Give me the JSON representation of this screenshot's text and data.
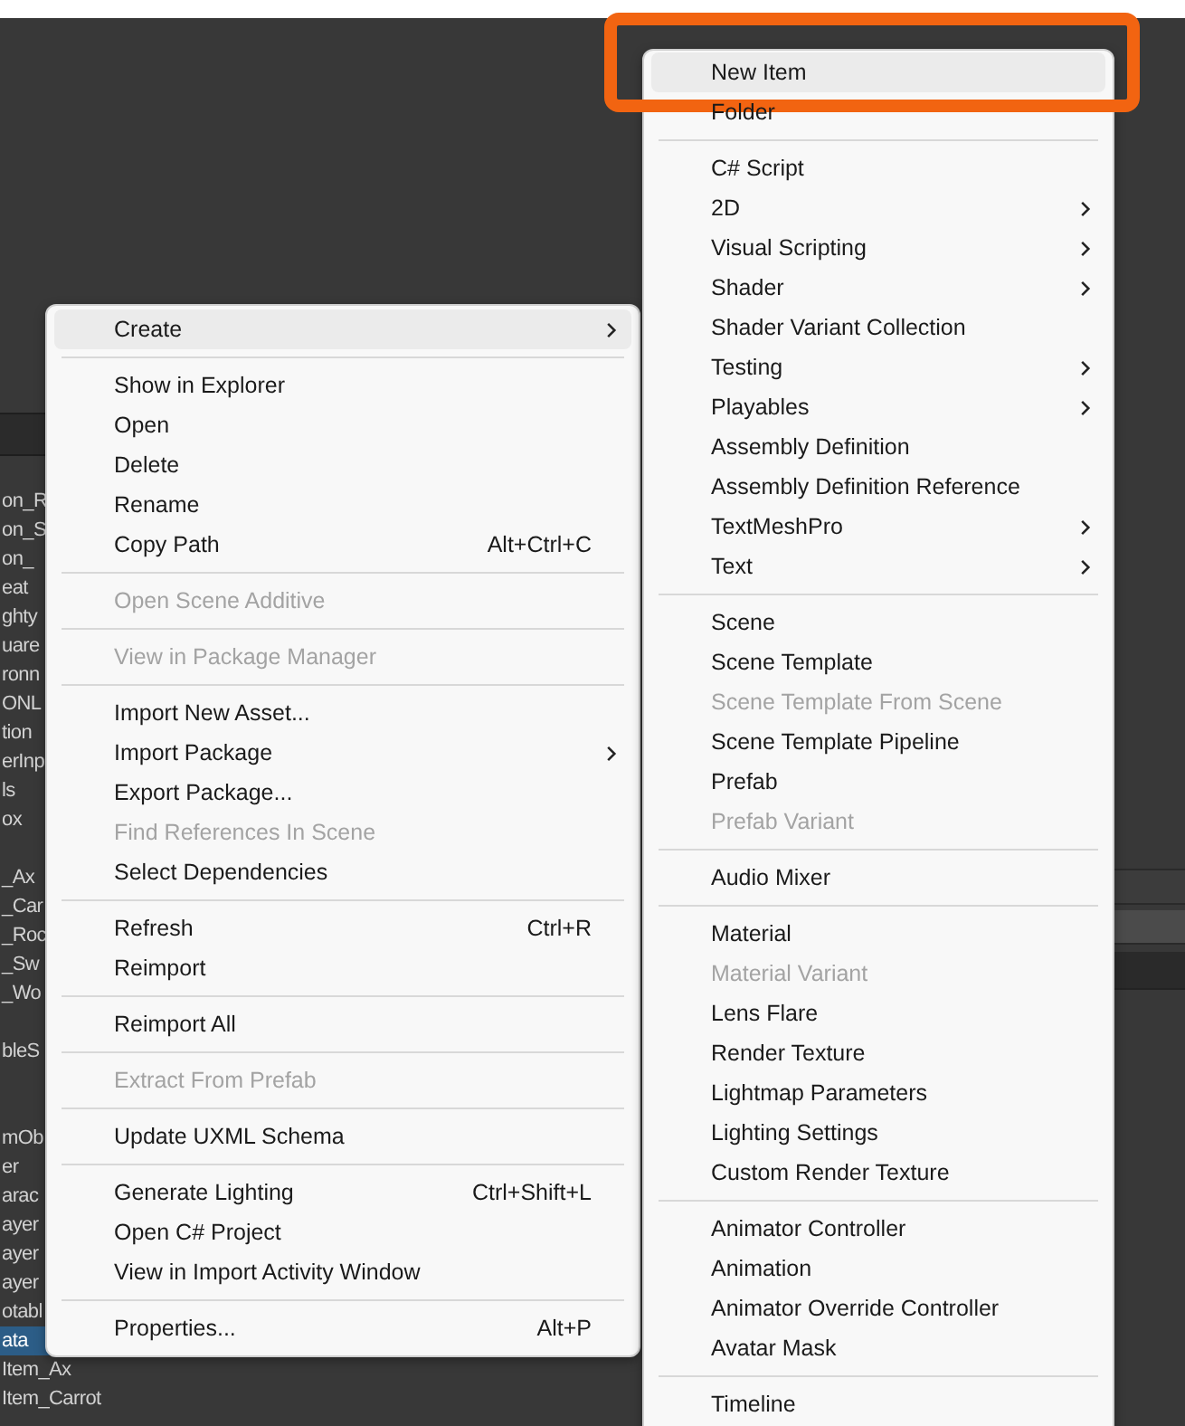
{
  "project_list": [
    {
      "kind": "name",
      "text": "on_R",
      "selected": false
    },
    {
      "kind": "name",
      "text": "on_S",
      "selected": false
    },
    {
      "kind": "name",
      "text": "on_",
      "selected": false
    },
    {
      "kind": "name",
      "text": "eat",
      "selected": false
    },
    {
      "kind": "name",
      "text": "ghty",
      "selected": false
    },
    {
      "kind": "name",
      "text": "uare",
      "selected": false
    },
    {
      "kind": "name",
      "text": "ronn",
      "selected": false
    },
    {
      "kind": "name",
      "text": "ONL",
      "selected": false
    },
    {
      "kind": "name",
      "text": "tion",
      "selected": false
    },
    {
      "kind": "name",
      "text": "erInp",
      "selected": false
    },
    {
      "kind": "name",
      "text": "ls",
      "selected": false
    },
    {
      "kind": "name",
      "text": "ox",
      "selected": false
    },
    {
      "kind": "empty"
    },
    {
      "kind": "name",
      "text": "_Ax",
      "selected": false
    },
    {
      "kind": "name",
      "text": "_Car",
      "selected": false
    },
    {
      "kind": "name",
      "text": "_Roc",
      "selected": false
    },
    {
      "kind": "name",
      "text": "_Sw",
      "selected": false
    },
    {
      "kind": "name",
      "text": "_Wo",
      "selected": false
    },
    {
      "kind": "empty"
    },
    {
      "kind": "name",
      "text": "bleS",
      "selected": false
    },
    {
      "kind": "empty"
    },
    {
      "kind": "empty"
    },
    {
      "kind": "name",
      "text": "mOb",
      "selected": false
    },
    {
      "kind": "name",
      "text": "er",
      "selected": false
    },
    {
      "kind": "name",
      "text": "arac",
      "selected": false
    },
    {
      "kind": "name",
      "text": "ayer",
      "selected": false
    },
    {
      "kind": "name",
      "text": "ayer",
      "selected": false
    },
    {
      "kind": "name",
      "text": "ayer",
      "selected": false
    },
    {
      "kind": "name",
      "text": "otabl",
      "selected": false
    },
    {
      "kind": "name",
      "text": "ata",
      "selected": true
    },
    {
      "kind": "name",
      "text": "Item_Ax",
      "selected": false
    },
    {
      "kind": "name",
      "text": "Item_Carrot",
      "selected": false
    }
  ],
  "context_menu": {
    "items": [
      {
        "kind": "item",
        "label": "Create",
        "submenu": true,
        "highlighted": true,
        "disabled": false
      },
      {
        "kind": "separator"
      },
      {
        "kind": "item",
        "label": "Show in Explorer",
        "submenu": false,
        "highlighted": false,
        "disabled": false
      },
      {
        "kind": "item",
        "label": "Open",
        "submenu": false,
        "highlighted": false,
        "disabled": false
      },
      {
        "kind": "item",
        "label": "Delete",
        "submenu": false,
        "highlighted": false,
        "disabled": false
      },
      {
        "kind": "item",
        "label": "Rename",
        "submenu": false,
        "highlighted": false,
        "disabled": false
      },
      {
        "kind": "item",
        "label": "Copy Path",
        "shortcut": "Alt+Ctrl+C",
        "submenu": false,
        "highlighted": false,
        "disabled": false
      },
      {
        "kind": "separator"
      },
      {
        "kind": "item",
        "label": "Open Scene Additive",
        "submenu": false,
        "highlighted": false,
        "disabled": true
      },
      {
        "kind": "separator"
      },
      {
        "kind": "item",
        "label": "View in Package Manager",
        "submenu": false,
        "highlighted": false,
        "disabled": true
      },
      {
        "kind": "separator"
      },
      {
        "kind": "item",
        "label": "Import New Asset...",
        "submenu": false,
        "highlighted": false,
        "disabled": false
      },
      {
        "kind": "item",
        "label": "Import Package",
        "submenu": true,
        "highlighted": false,
        "disabled": false
      },
      {
        "kind": "item",
        "label": "Export Package...",
        "submenu": false,
        "highlighted": false,
        "disabled": false
      },
      {
        "kind": "item",
        "label": "Find References In Scene",
        "submenu": false,
        "highlighted": false,
        "disabled": true
      },
      {
        "kind": "item",
        "label": "Select Dependencies",
        "submenu": false,
        "highlighted": false,
        "disabled": false
      },
      {
        "kind": "separator"
      },
      {
        "kind": "item",
        "label": "Refresh",
        "shortcut": "Ctrl+R",
        "submenu": false,
        "highlighted": false,
        "disabled": false
      },
      {
        "kind": "item",
        "label": "Reimport",
        "submenu": false,
        "highlighted": false,
        "disabled": false
      },
      {
        "kind": "separator"
      },
      {
        "kind": "item",
        "label": "Reimport All",
        "submenu": false,
        "highlighted": false,
        "disabled": false
      },
      {
        "kind": "separator"
      },
      {
        "kind": "item",
        "label": "Extract From Prefab",
        "submenu": false,
        "highlighted": false,
        "disabled": true
      },
      {
        "kind": "separator"
      },
      {
        "kind": "item",
        "label": "Update UXML Schema",
        "submenu": false,
        "highlighted": false,
        "disabled": false
      },
      {
        "kind": "separator"
      },
      {
        "kind": "item",
        "label": "Generate Lighting",
        "shortcut": "Ctrl+Shift+L",
        "submenu": false,
        "highlighted": false,
        "disabled": false
      },
      {
        "kind": "item",
        "label": "Open C# Project",
        "submenu": false,
        "highlighted": false,
        "disabled": false
      },
      {
        "kind": "item",
        "label": "View in Import Activity Window",
        "submenu": false,
        "highlighted": false,
        "disabled": false
      },
      {
        "kind": "separator"
      },
      {
        "kind": "item",
        "label": "Properties...",
        "shortcut": "Alt+P",
        "submenu": false,
        "highlighted": false,
        "disabled": false
      }
    ]
  },
  "create_submenu": {
    "items": [
      {
        "kind": "item",
        "label": "New Item",
        "submenu": false,
        "highlighted": true,
        "outlined": true,
        "disabled": false
      },
      {
        "kind": "item",
        "label": "Folder",
        "submenu": false,
        "highlighted": false,
        "disabled": false
      },
      {
        "kind": "separator"
      },
      {
        "kind": "item",
        "label": "C# Script",
        "submenu": false,
        "highlighted": false,
        "disabled": false
      },
      {
        "kind": "item",
        "label": "2D",
        "submenu": true,
        "highlighted": false,
        "disabled": false
      },
      {
        "kind": "item",
        "label": "Visual Scripting",
        "submenu": true,
        "highlighted": false,
        "disabled": false
      },
      {
        "kind": "item",
        "label": "Shader",
        "submenu": true,
        "highlighted": false,
        "disabled": false
      },
      {
        "kind": "item",
        "label": "Shader Variant Collection",
        "submenu": false,
        "highlighted": false,
        "disabled": false
      },
      {
        "kind": "item",
        "label": "Testing",
        "submenu": true,
        "highlighted": false,
        "disabled": false
      },
      {
        "kind": "item",
        "label": "Playables",
        "submenu": true,
        "highlighted": false,
        "disabled": false
      },
      {
        "kind": "item",
        "label": "Assembly Definition",
        "submenu": false,
        "highlighted": false,
        "disabled": false
      },
      {
        "kind": "item",
        "label": "Assembly Definition Reference",
        "submenu": false,
        "highlighted": false,
        "disabled": false
      },
      {
        "kind": "item",
        "label": "TextMeshPro",
        "submenu": true,
        "highlighted": false,
        "disabled": false
      },
      {
        "kind": "item",
        "label": "Text",
        "submenu": true,
        "highlighted": false,
        "disabled": false
      },
      {
        "kind": "separator"
      },
      {
        "kind": "item",
        "label": "Scene",
        "submenu": false,
        "highlighted": false,
        "disabled": false
      },
      {
        "kind": "item",
        "label": "Scene Template",
        "submenu": false,
        "highlighted": false,
        "disabled": false
      },
      {
        "kind": "item",
        "label": "Scene Template From Scene",
        "submenu": false,
        "highlighted": false,
        "disabled": true
      },
      {
        "kind": "item",
        "label": "Scene Template Pipeline",
        "submenu": false,
        "highlighted": false,
        "disabled": false
      },
      {
        "kind": "item",
        "label": "Prefab",
        "submenu": false,
        "highlighted": false,
        "disabled": false
      },
      {
        "kind": "item",
        "label": "Prefab Variant",
        "submenu": false,
        "highlighted": false,
        "disabled": true
      },
      {
        "kind": "separator"
      },
      {
        "kind": "item",
        "label": "Audio Mixer",
        "submenu": false,
        "highlighted": false,
        "disabled": false
      },
      {
        "kind": "separator"
      },
      {
        "kind": "item",
        "label": "Material",
        "submenu": false,
        "highlighted": false,
        "disabled": false
      },
      {
        "kind": "item",
        "label": "Material Variant",
        "submenu": false,
        "highlighted": false,
        "disabled": true
      },
      {
        "kind": "item",
        "label": "Lens Flare",
        "submenu": false,
        "highlighted": false,
        "disabled": false
      },
      {
        "kind": "item",
        "label": "Render Texture",
        "submenu": false,
        "highlighted": false,
        "disabled": false
      },
      {
        "kind": "item",
        "label": "Lightmap Parameters",
        "submenu": false,
        "highlighted": false,
        "disabled": false
      },
      {
        "kind": "item",
        "label": "Lighting Settings",
        "submenu": false,
        "highlighted": false,
        "disabled": false
      },
      {
        "kind": "item",
        "label": "Custom Render Texture",
        "submenu": false,
        "highlighted": false,
        "disabled": false
      },
      {
        "kind": "separator"
      },
      {
        "kind": "item",
        "label": "Animator Controller",
        "submenu": false,
        "highlighted": false,
        "disabled": false
      },
      {
        "kind": "item",
        "label": "Animation",
        "submenu": false,
        "highlighted": false,
        "disabled": false
      },
      {
        "kind": "item",
        "label": "Animator Override Controller",
        "submenu": false,
        "highlighted": false,
        "disabled": false
      },
      {
        "kind": "item",
        "label": "Avatar Mask",
        "submenu": false,
        "highlighted": false,
        "disabled": false
      },
      {
        "kind": "separator"
      },
      {
        "kind": "item",
        "label": "Timeline",
        "submenu": false,
        "highlighted": false,
        "disabled": false
      }
    ]
  }
}
